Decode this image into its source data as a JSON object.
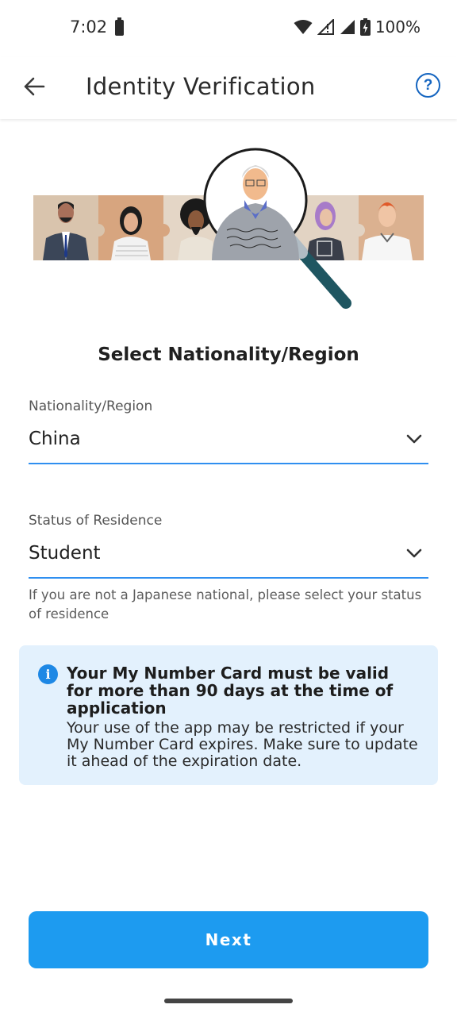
{
  "status_bar": {
    "time": "7:02",
    "battery_percent": "100%"
  },
  "app_bar": {
    "title": "Identity Verification",
    "help_label": "?"
  },
  "section_title": "Select Nationality/Region",
  "nationality": {
    "label": "Nationality/Region",
    "value": "China"
  },
  "residence": {
    "label": "Status of Residence",
    "value": "Student"
  },
  "helper_text": "If you are not a Japanese national, please select your status of residence",
  "info_card": {
    "icon_glyph": "i",
    "title": "Your My Number Card must be valid for more than 90 days at the time of application",
    "body": "Your use of the app may be restricted if your My Number Card expires. Make sure to update it ahead of the expiration date."
  },
  "next_button": "Next",
  "colors": {
    "accent": "#1d9bf0",
    "underline": "#2f8ff0",
    "info_bg": "#e3f1fd",
    "info_icon": "#1e88e5",
    "help_icon": "#1565c0"
  }
}
